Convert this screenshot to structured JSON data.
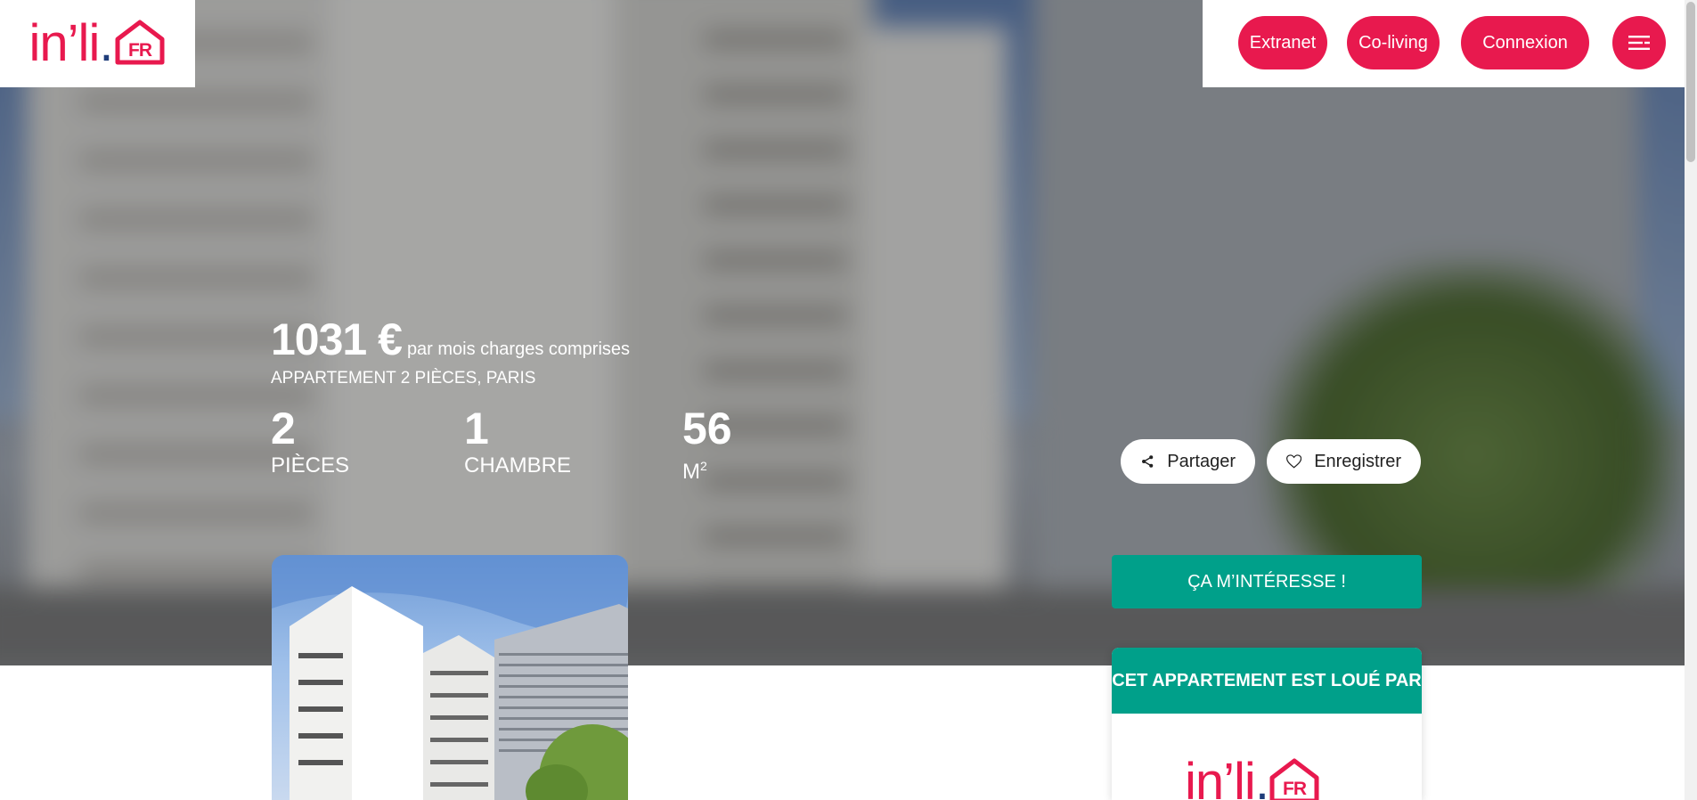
{
  "brand": {
    "logo_text": "in’li",
    "logo_dot": ".",
    "logo_suffix": "FR"
  },
  "nav": {
    "extranet": "Extranet",
    "coliving": "Co-living",
    "connexion": "Connexion",
    "menu_icon": "menu-lines-icon"
  },
  "listing": {
    "price": "1031 €",
    "price_note": "par mois charges comprises",
    "subtitle": "APPARTEMENT 2 PIÈCES, PARIS",
    "stats": [
      {
        "value": "2",
        "label": "PIÈCES"
      },
      {
        "value": "1",
        "label": "CHAMBRE"
      },
      {
        "value": "56",
        "label": "M",
        "sup": "2"
      }
    ]
  },
  "actions": {
    "share": "Partager",
    "share_icon": "share-icon",
    "save": "Enregistrer",
    "save_icon": "heart-icon"
  },
  "sidebar": {
    "interest_button": "ÇA M’INTÉRESSE !",
    "landlord_title": "CET APPARTEMENT EST LOUÉ PAR"
  },
  "colors": {
    "brand_pink": "#e8194e",
    "brand_navy": "#1f3d7a",
    "teal": "#00a08a"
  }
}
